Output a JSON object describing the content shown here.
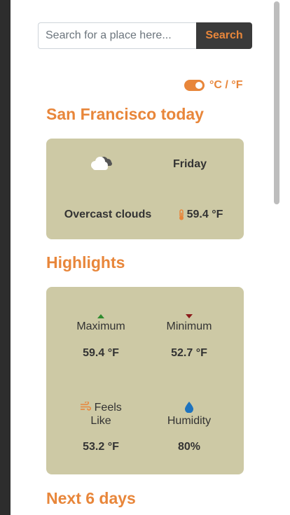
{
  "search": {
    "placeholder": "Search for a place here...",
    "button_label": "Search"
  },
  "units": {
    "label": "°C / °F",
    "mode": "fahrenheit"
  },
  "today": {
    "title": "San Francisco today",
    "day": "Friday",
    "condition": "Overcast clouds",
    "temperature": "59.4 °F",
    "weather_icon": "cloud-icon"
  },
  "highlights": {
    "title": "Highlights",
    "maximum_label": "Maximum",
    "maximum_value": "59.4 °F",
    "minimum_label": "Minimum",
    "minimum_value": "52.7 °F",
    "feels_like_label": "Feels Like",
    "feels_like_value": "53.2 °F",
    "humidity_label": "Humidity",
    "humidity_value": "80%"
  },
  "forecast": {
    "title": "Next 6 days"
  },
  "colors": {
    "accent": "#e8863a",
    "card": "#cdc9a5",
    "up": "#2e8b2e",
    "down": "#8b1a1a",
    "humidity": "#1e73be"
  }
}
